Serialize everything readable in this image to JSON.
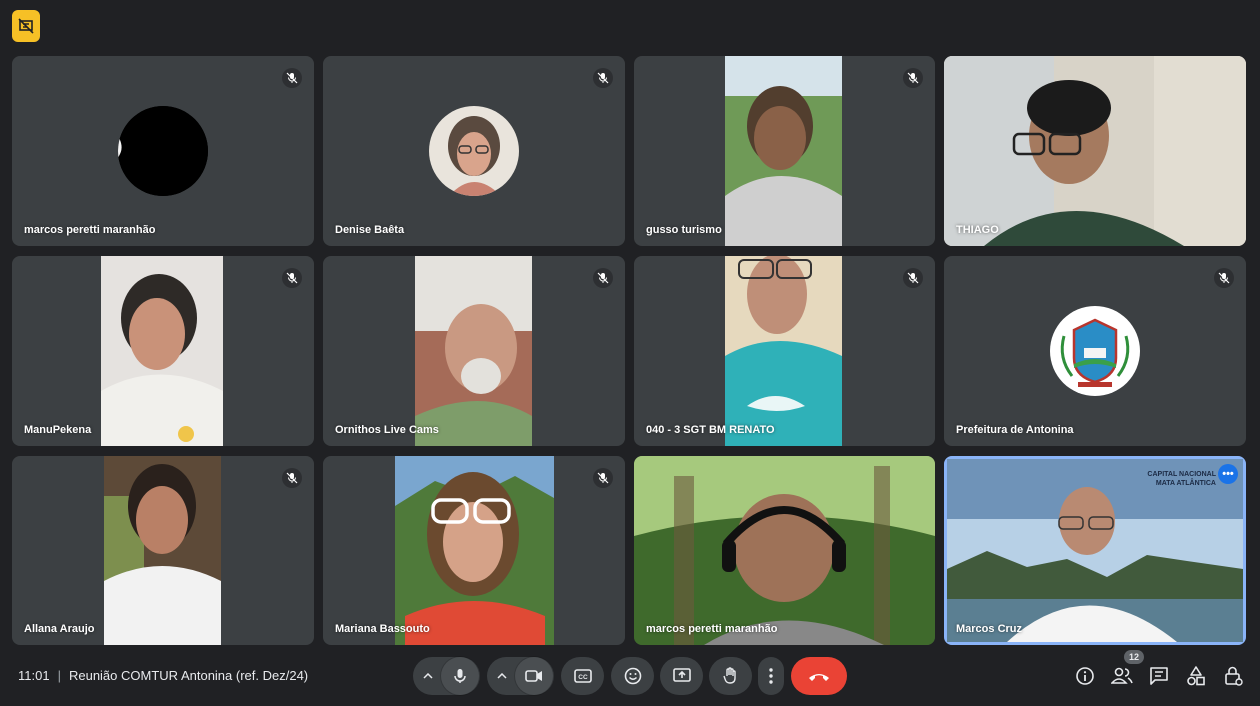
{
  "participants": [
    {
      "name": "marcos peretti maranhão",
      "muted": true
    },
    {
      "name": "Denise Baêta",
      "muted": true
    },
    {
      "name": "gusso turismo",
      "muted": true
    },
    {
      "name": "THIAGO",
      "muted": false
    },
    {
      "name": "ManuPekena",
      "muted": true
    },
    {
      "name": "Ornithos Live Cams",
      "muted": true
    },
    {
      "name": "040 - 3 SGT BM RENATO",
      "muted": true
    },
    {
      "name": "Prefeitura de Antonina",
      "muted": true
    },
    {
      "name": "Allana Araujo",
      "muted": true
    },
    {
      "name": "Mariana Bassouto",
      "muted": true
    },
    {
      "name": "marcos peretti maranhão",
      "muted": false
    },
    {
      "name": "Marcos Cruz",
      "muted": false,
      "active": true,
      "background_text_line1": "CAPITAL NACIONAL",
      "background_text_line2": "MATA ATLÂNTICA"
    }
  ],
  "meeting": {
    "time": "11:01",
    "separator": "|",
    "title": "Reunião COMTUR Antonina (ref. Dez/24)"
  },
  "people_count": "12",
  "icons": {
    "top_badge": "presentation-off-icon",
    "mute": "mic-off-icon",
    "mic": "mic-icon",
    "camera": "camera-icon",
    "captions": "captions-icon",
    "emoji": "emoji-icon",
    "present": "present-icon",
    "hand": "raise-hand-icon",
    "more": "more-vert-icon",
    "end": "end-call-icon",
    "info": "info-icon",
    "people": "people-icon",
    "chat": "chat-icon",
    "activities": "activities-icon",
    "host": "host-controls-icon"
  },
  "colors": {
    "background": "#202124",
    "tile": "#3c4043",
    "active_border": "#8ab4f8",
    "end_call": "#ea4335",
    "badge": "#f6c026"
  }
}
